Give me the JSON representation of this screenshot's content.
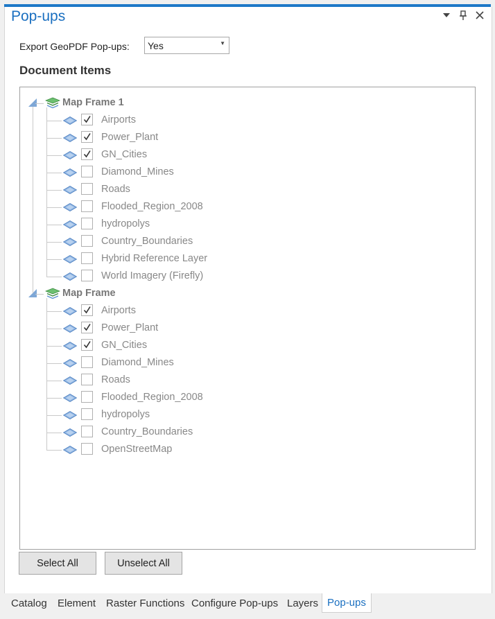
{
  "accent": "#1e79c8",
  "window": {
    "title": "Pop-ups",
    "controls": [
      "chevron-down-icon",
      "pin-icon",
      "close-icon"
    ]
  },
  "export": {
    "label": "Export GeoPDF Pop-ups:",
    "value": "Yes"
  },
  "document_items": {
    "title": "Document Items"
  },
  "tree": [
    {
      "label": "Map Frame 1",
      "layers": [
        {
          "name": "Airports",
          "checked": true
        },
        {
          "name": "Power_Plant",
          "checked": true
        },
        {
          "name": "GN_Cities",
          "checked": true
        },
        {
          "name": "Diamond_Mines",
          "checked": false
        },
        {
          "name": "Roads",
          "checked": false
        },
        {
          "name": "Flooded_Region_2008",
          "checked": false
        },
        {
          "name": "hydropolys",
          "checked": false
        },
        {
          "name": "Country_Boundaries",
          "checked": false
        },
        {
          "name": "Hybrid Reference Layer",
          "checked": false
        },
        {
          "name": "World Imagery (Firefly)",
          "checked": false
        }
      ]
    },
    {
      "label": "Map Frame",
      "layers": [
        {
          "name": "Airports",
          "checked": true
        },
        {
          "name": "Power_Plant",
          "checked": true
        },
        {
          "name": "GN_Cities",
          "checked": true
        },
        {
          "name": "Diamond_Mines",
          "checked": false
        },
        {
          "name": "Roads",
          "checked": false
        },
        {
          "name": "Flooded_Region_2008",
          "checked": false
        },
        {
          "name": "hydropolys",
          "checked": false
        },
        {
          "name": "Country_Boundaries",
          "checked": false
        },
        {
          "name": "OpenStreetMap",
          "checked": false
        }
      ]
    }
  ],
  "buttons": {
    "select_all": "Select All",
    "unselect_all": "Unselect All"
  },
  "tabs": [
    {
      "label": "Catalog",
      "active": false
    },
    {
      "label": "Element",
      "active": false
    },
    {
      "label": "Raster Functions",
      "active": false
    },
    {
      "label": "Configure Pop-ups",
      "active": false
    },
    {
      "label": "Layers",
      "active": false
    },
    {
      "label": "Pop-ups",
      "active": true
    }
  ]
}
